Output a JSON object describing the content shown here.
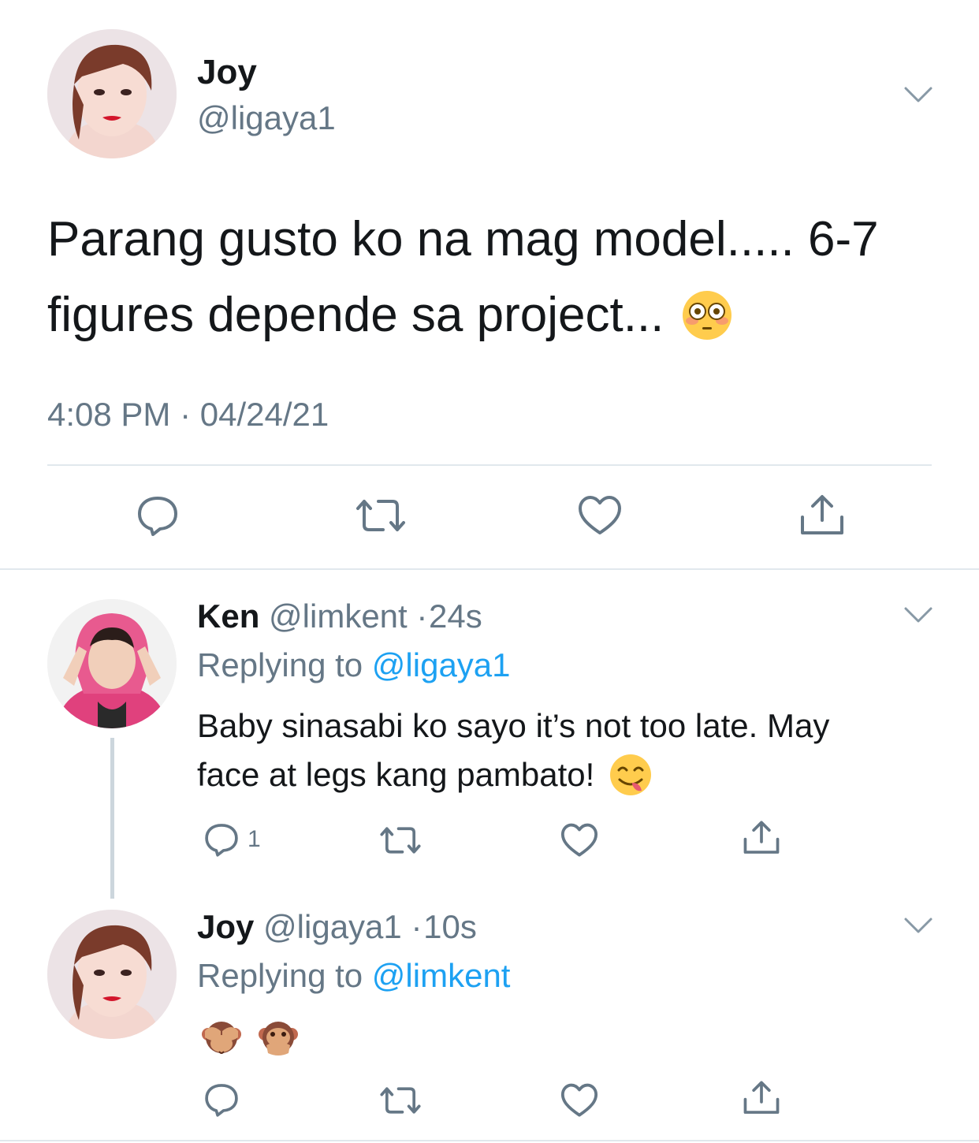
{
  "main_tweet": {
    "name": "Joy",
    "handle": "@ligaya1",
    "text_line1": "Parang gusto ko na mag model..... 6-7",
    "text_line2": "figures depende sa project...",
    "timestamp": "4:08 PM · 04/24/21",
    "emoji": "flushed-face"
  },
  "replies": [
    {
      "name": "Ken",
      "handle": "@limkent",
      "separator": "·",
      "age": "24s",
      "replying_prefix": "Replying to",
      "replying_to": "@ligaya1",
      "text_line1": "Baby sinasabi ko sayo it’s not too late. May",
      "text_line2": "face at legs kang pambato!",
      "emoji": "face-savoring-food",
      "reply_count": "1"
    },
    {
      "name": "Joy",
      "handle": "@ligaya1",
      "separator": "·",
      "age": "10s",
      "replying_prefix": "Replying to",
      "replying_to": "@limkent",
      "emojis": [
        "see-no-evil-monkey",
        "speak-no-evil-monkey"
      ]
    }
  ],
  "colors": {
    "text": "#14171a",
    "muted": "#657786",
    "link": "#1da1f2",
    "divider": "#e1e8ed"
  }
}
